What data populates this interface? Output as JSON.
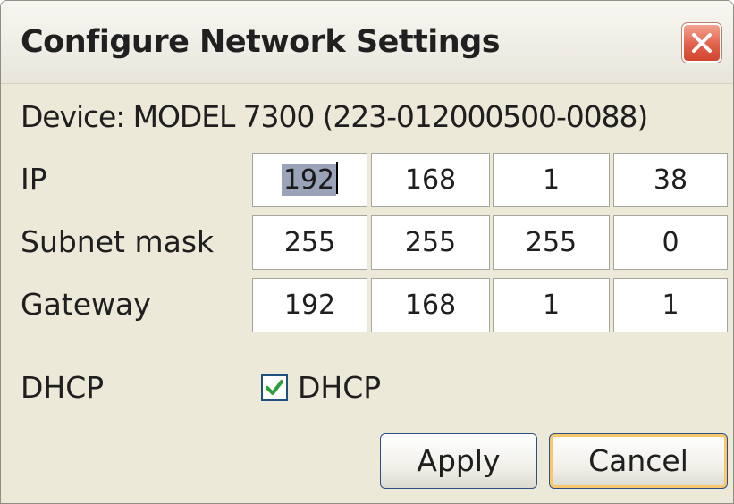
{
  "window": {
    "title": "Configure Network Settings"
  },
  "device": {
    "text": "Device: MODEL 7300 (223-012000500-0088)"
  },
  "rows": {
    "ip": {
      "label": "IP",
      "octets": [
        "192",
        "168",
        "1",
        "38"
      ]
    },
    "subnet": {
      "label": "Subnet mask",
      "octets": [
        "255",
        "255",
        "255",
        "0"
      ]
    },
    "gateway": {
      "label": "Gateway",
      "octets": [
        "192",
        "168",
        "1",
        "1"
      ]
    }
  },
  "dhcp": {
    "label": "DHCP",
    "checkbox_label": "DHCP",
    "checked": true
  },
  "buttons": {
    "apply": "Apply",
    "cancel": "Cancel"
  },
  "colors": {
    "close_button": "#e3604a",
    "checkmark": "#2f9e3a",
    "selection": "#9aa3b8",
    "default_button_focus": "#f6c76d"
  },
  "icons": {
    "close": "close-icon",
    "check": "checkmark-icon"
  }
}
